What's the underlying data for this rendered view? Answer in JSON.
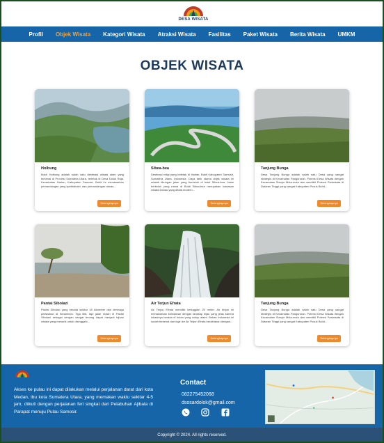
{
  "site": {
    "logo_text": "DESA WISATA",
    "title": "OBJEK WISATA"
  },
  "nav": {
    "items": [
      {
        "label": "Profil",
        "active": false
      },
      {
        "label": "Objek Wisata",
        "active": true
      },
      {
        "label": "Kategori Wisata",
        "active": false
      },
      {
        "label": "Atraksi Wisata",
        "active": false
      },
      {
        "label": "Fasilitas",
        "active": false
      },
      {
        "label": "Paket Wisata",
        "active": false
      },
      {
        "label": "Berita Wisata",
        "active": false
      },
      {
        "label": "UMKM",
        "active": false
      }
    ]
  },
  "cards": [
    {
      "title": "Holbung",
      "text": "Bukit Holbung adalah salah satu destinasi wisata alam yang terkenal di Provinsi Sumatera Utara, terletak di Desa Dolok Raja, Kecamatan Harian, Kabupaten Samosir. Bukit ini menawarkan pemandangan yang spektakuler, dan pemandangan danau...",
      "button": "Selengkapnya"
    },
    {
      "title": "Sibea-bea",
      "text": "Destinasi religi yang terletak di Harian, Bukit Kabupaten Samosir, Sumatera Utara, Indonesia. Daya tarik utama objek wisata ini adalah tikungan jalan yang berkelok di bukit Sibea-bea. Jalan berkelok yang ramai di Bukit Sibea-bea merupakan kawasan wisata Danau yang ditata modern...",
      "button": "Selengkapnya"
    },
    {
      "title": "Tanjung Bunga",
      "text": "Desa Tanjung Bunga adalah salah satu Desa yang sangat strategis di Kecamatan Pangururan. Potensi Desa Wisata dengan Kecamatan Sianjur Mula-mula dan memiliki Potensi Pariwisata di Dataran Tinggi yang sangat Kabupaten Pusuk Buhit...",
      "button": "Selengkapnya"
    },
    {
      "title": "Pantai Sibolazi",
      "text": "Pantai Sibolazi yang berada sekitar 18 kilometer dari dermaga pelabuhan di Simanindo. Tiga titik, tapi jalan masih di Pantai Sibolazi sebagai dengan sangat tenang dapat menjadi tujuan wisata yang menarik untuk disinggahi...",
      "button": "Selengkapnya"
    },
    {
      "title": "Air Terjun Efrata",
      "text": "Air Terjun Efrata memiliki ketinggian 25 meter. Air terjun ini menawarkan keindahan dengan lanskap hijau yang jelas karena lokasinya berada di hutan yang cukup alami. Bebas Indonesia ini sudah terkenal dan ingin ke Air Terjun Efrata berdetakan dengan...",
      "button": "Selengkapnya"
    },
    {
      "title": "Tanjung Bunga",
      "text": "Desa Tanjung Bunga adalah salah satu Desa yang sangat strategis di Kecamatan Pangururan. Potensi Desa Wisata dengan Kecamatan Sianjur Mula-mula dan memiliki Potensi Pariwisata di Dataran Tinggi yang sangat Kabupaten Pusuk Buhit...",
      "button": "Selengkapnya"
    }
  ],
  "footer": {
    "description": "Akses ke pulau ini dapat dilakukan melalui perjalanan darat dari kota Medan, ibu kota Sumatera Utara, yang memakan waktu sekitar 4-5 jam, diikuti dengan perjalanan feri singkat dari Pelabuhan Ajibata di Parapat menuju Pulau Samosir.",
    "contact_title": "Contact",
    "phone": "082275452068",
    "email": "dsosardolok@gmail.com",
    "social_icons": [
      "whatsapp-icon",
      "instagram-icon",
      "facebook-icon"
    ],
    "copyright": "Copyright © 2024. All rights reserved."
  },
  "colors": {
    "brand_blue": "#1565a8",
    "title_navy": "#1d3a5c",
    "accent_orange": "#f0892a",
    "nav_active": "#f0a23a",
    "copyright_bar": "#2b5176"
  }
}
